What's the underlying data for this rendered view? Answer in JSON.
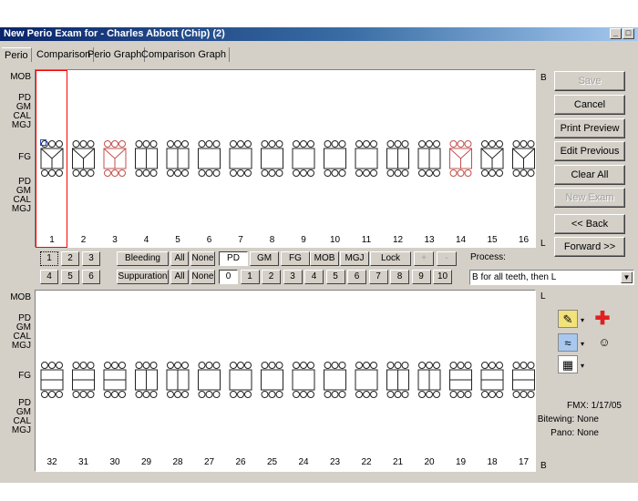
{
  "window": {
    "title": "New Perio Exam for - Charles Abbott (Chip) (2)",
    "min_btn": "_",
    "max_btn": "□"
  },
  "tabs": [
    "Perio",
    "Comparison",
    "Perio Graph",
    "Comparison Graph"
  ],
  "upper": {
    "row_labels_top": [
      "MOB",
      "PD",
      "GM",
      "CAL",
      "MGJ"
    ],
    "fg_label": "FG",
    "row_labels_bottom": [
      "PD",
      "GM",
      "CAL",
      "MGJ"
    ],
    "side_top": "B",
    "side_bottom": "L",
    "teeth": [
      "1",
      "2",
      "3",
      "4",
      "5",
      "6",
      "7",
      "8",
      "9",
      "10",
      "11",
      "12",
      "13",
      "14",
      "15",
      "16"
    ],
    "missing_teeth": [
      "3",
      "14"
    ],
    "selected_tooth": "1"
  },
  "lower": {
    "row_labels_top": [
      "MOB",
      "PD",
      "GM",
      "CAL",
      "MGJ"
    ],
    "fg_label": "FG",
    "row_labels_bottom": [
      "PD",
      "GM",
      "CAL",
      "MGJ"
    ],
    "side_top": "L",
    "side_bottom": "B",
    "teeth": [
      "32",
      "31",
      "30",
      "29",
      "28",
      "27",
      "26",
      "25",
      "24",
      "23",
      "22",
      "21",
      "20",
      "19",
      "18",
      "17"
    ]
  },
  "right_buttons": {
    "save": "Save",
    "cancel": "Cancel",
    "print_preview": "Print Preview",
    "edit_previous": "Edit Previous",
    "clear_all": "Clear All",
    "new_exam": "New Exam",
    "back": "<< Back",
    "forward": "Forward >>"
  },
  "controls": {
    "num_row1": [
      "1",
      "2",
      "3"
    ],
    "num_row2": [
      "4",
      "5",
      "6"
    ],
    "bleeding": "Bleeding",
    "suppuration": "Suppuration",
    "all": "All",
    "none": "None",
    "modes": [
      "PD",
      "GM",
      "FG",
      "MOB",
      "MGJ"
    ],
    "lock": "Lock",
    "plus": "+",
    "minus": "-",
    "digits": [
      "0",
      "1",
      "2",
      "3",
      "4",
      "5",
      "6",
      "7",
      "8",
      "9",
      "10"
    ],
    "process_label": "Process:",
    "process_value": "B for all teeth, then L"
  },
  "icons": [
    "note-icon",
    "medical-cross-icon",
    "xray-icon",
    "tooth-icon",
    "patient-icon"
  ],
  "info": {
    "fmx": "FMX: 1/17/05",
    "bitewing": "Bitewing: None",
    "pano": "Pano: None"
  },
  "colors": {
    "missing": "#c0504d",
    "selection": "#ff0000",
    "title_bar": "#0a246a"
  }
}
